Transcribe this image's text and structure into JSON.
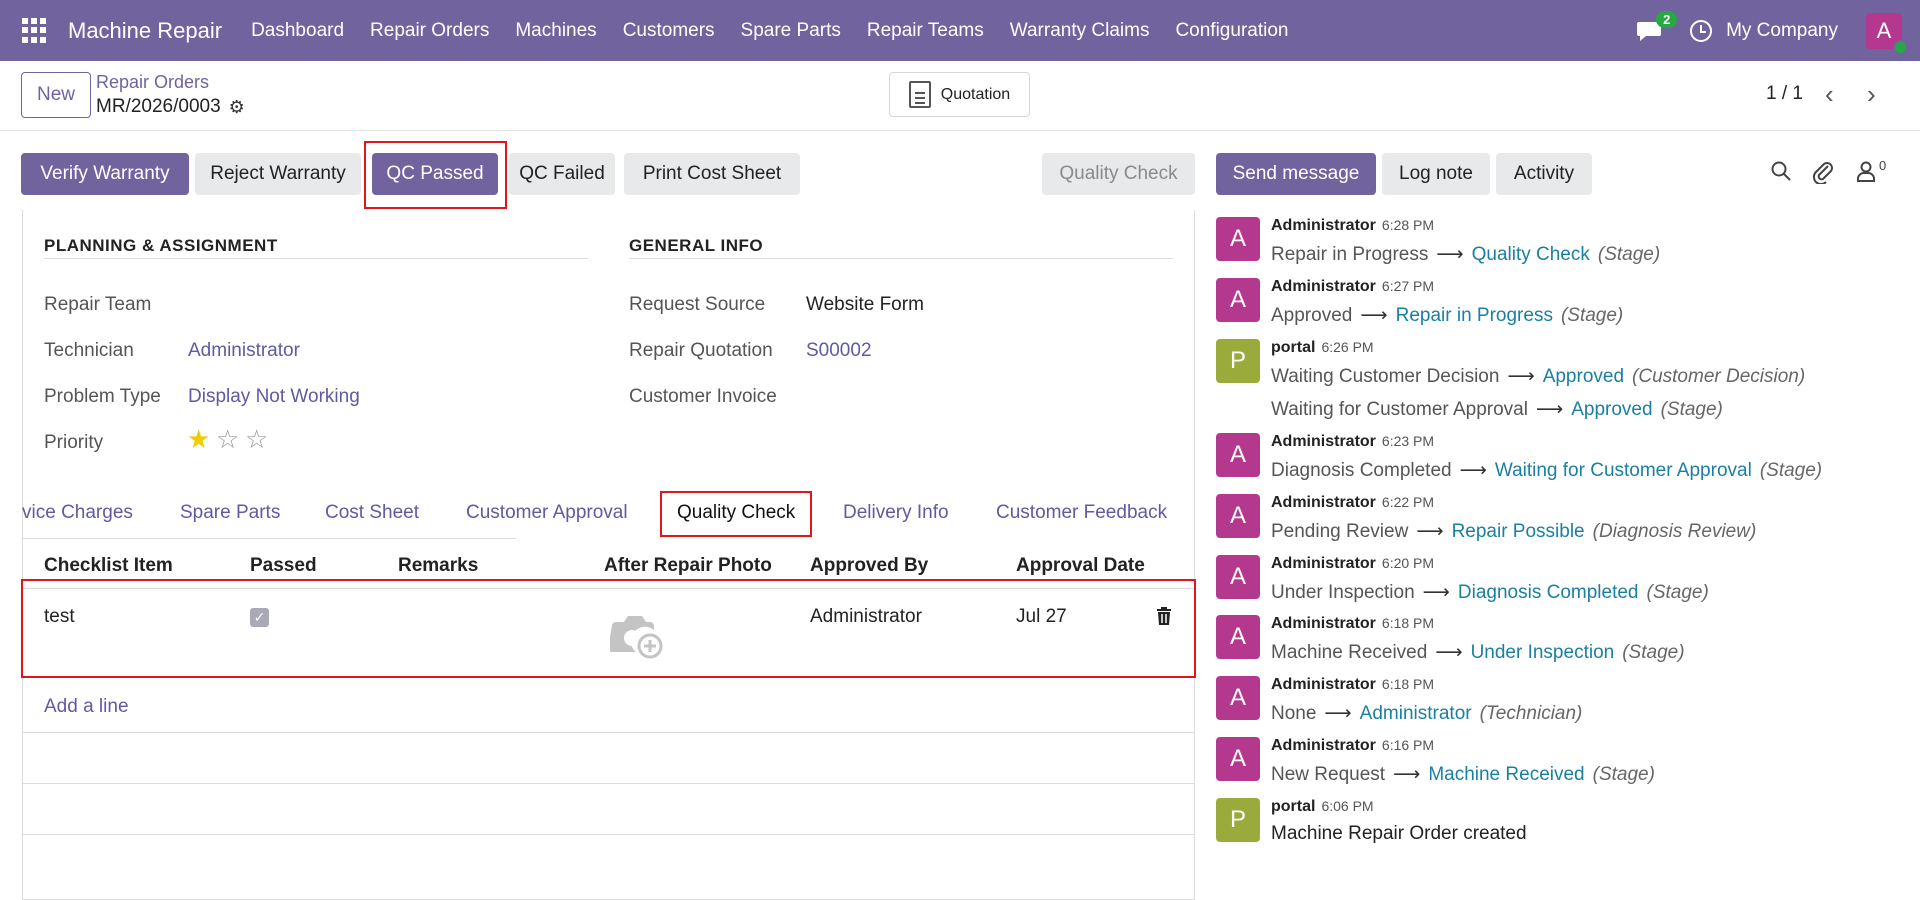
{
  "navbar": {
    "brand": "Machine Repair",
    "items": [
      "Dashboard",
      "Repair Orders",
      "Machines",
      "Customers",
      "Spare Parts",
      "Repair Teams",
      "Warranty Claims",
      "Configuration"
    ],
    "chat_count": "2",
    "company": "My Company",
    "avatar_letter": "A"
  },
  "control": {
    "new_label": "New",
    "breadcrumb_parent": "Repair Orders",
    "record_name": "MR/2026/0003",
    "quotation_label": "Quotation",
    "pager": "1 / 1"
  },
  "actions": {
    "verify_warranty": "Verify Warranty",
    "reject_warranty": "Reject Warranty",
    "qc_passed": "QC Passed",
    "qc_failed": "QC Failed",
    "print_cost_sheet": "Print Cost Sheet",
    "stage": "Quality Check"
  },
  "chatter_buttons": {
    "send_message": "Send message",
    "log_note": "Log note",
    "activity": "Activity",
    "followers": "0"
  },
  "planning": {
    "title": "PLANNING & ASSIGNMENT",
    "repair_team_label": "Repair Team",
    "repair_team_value": "",
    "technician_label": "Technician",
    "technician_value": "Administrator",
    "problem_type_label": "Problem Type",
    "problem_type_value": "Display Not Working",
    "priority_label": "Priority",
    "priority_stars": 1
  },
  "general": {
    "title": "GENERAL INFO",
    "request_source_label": "Request Source",
    "request_source_value": "Website Form",
    "repair_quotation_label": "Repair Quotation",
    "repair_quotation_value": "S00002",
    "customer_invoice_label": "Customer Invoice",
    "customer_invoice_value": ""
  },
  "tabs": [
    "vice Charges",
    "Spare Parts",
    "Cost Sheet",
    "Customer Approval",
    "Quality Check",
    "Delivery Info",
    "Customer Feedback"
  ],
  "table": {
    "headers": [
      "Checklist Item",
      "Passed",
      "Remarks",
      "After Repair Photo",
      "Approved By",
      "Approval Date"
    ],
    "row": {
      "item": "test",
      "passed": true,
      "remarks": "",
      "approved_by": "Administrator",
      "approval_date": "Jul 27"
    },
    "add_line": "Add a line"
  },
  "messages": [
    {
      "avatar": "A",
      "author": "Administrator",
      "time": "6:28 PM",
      "changes": [
        {
          "old": "Repair in Progress",
          "new": "Quality Check",
          "field": "(Stage)"
        }
      ]
    },
    {
      "avatar": "A",
      "author": "Administrator",
      "time": "6:27 PM",
      "changes": [
        {
          "old": "Approved",
          "new": "Repair in Progress",
          "field": "(Stage)"
        }
      ]
    },
    {
      "avatar": "P",
      "author": "portal",
      "time": "6:26 PM",
      "changes": [
        {
          "old": "Waiting Customer Decision",
          "new": "Approved",
          "field": "(Customer Decision)"
        },
        {
          "old": "Waiting for Customer Approval",
          "new": "Approved",
          "field": "(Stage)"
        }
      ]
    },
    {
      "avatar": "A",
      "author": "Administrator",
      "time": "6:23 PM",
      "changes": [
        {
          "old": "Diagnosis Completed",
          "new": "Waiting for Customer Approval",
          "field": "(Stage)"
        }
      ]
    },
    {
      "avatar": "A",
      "author": "Administrator",
      "time": "6:22 PM",
      "changes": [
        {
          "old": "Pending Review",
          "new": "Repair Possible",
          "field": "(Diagnosis Review)"
        }
      ]
    },
    {
      "avatar": "A",
      "author": "Administrator",
      "time": "6:20 PM",
      "changes": [
        {
          "old": "Under Inspection",
          "new": "Diagnosis Completed",
          "field": "(Stage)"
        }
      ]
    },
    {
      "avatar": "A",
      "author": "Administrator",
      "time": "6:18 PM",
      "changes": [
        {
          "old": "Machine Received",
          "new": "Under Inspection",
          "field": "(Stage)"
        }
      ]
    },
    {
      "avatar": "A",
      "author": "Administrator",
      "time": "6:18 PM",
      "changes": [
        {
          "old": "None",
          "new": "Administrator",
          "field": "(Technician)"
        }
      ]
    },
    {
      "avatar": "A",
      "author": "Administrator",
      "time": "6:16 PM",
      "changes": [
        {
          "old": "New Request",
          "new": "Machine Received",
          "field": "(Stage)"
        }
      ]
    },
    {
      "avatar": "P",
      "author": "portal",
      "time": "6:06 PM",
      "body": "Machine Repair Order created"
    }
  ],
  "colors": {
    "brand": "#71639e",
    "avatar_admin": "#b5388f",
    "avatar_portal": "#9aab3c",
    "link": "#5f5aa2",
    "new_value": "#1a7fa1",
    "highlight": "#e0161d"
  }
}
